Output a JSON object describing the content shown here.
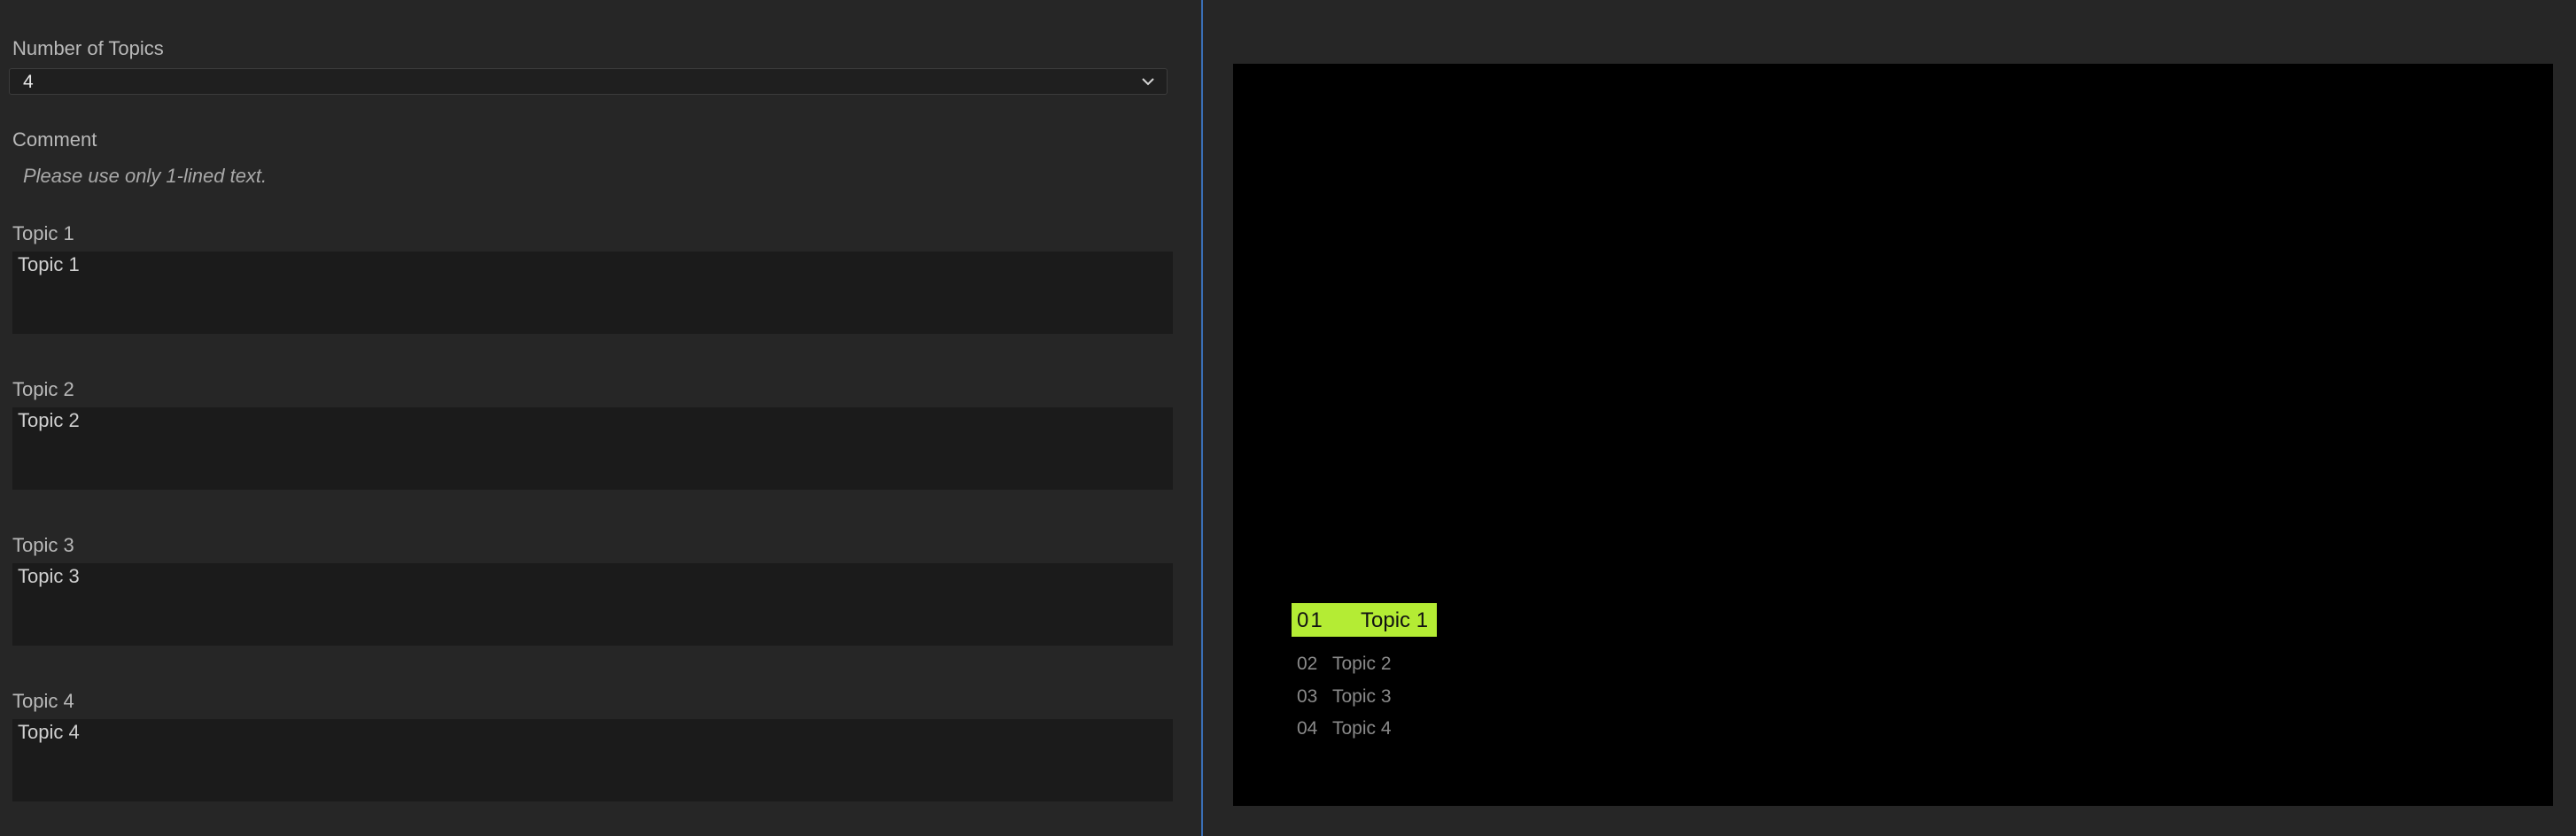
{
  "form": {
    "number_of_topics_label": "Number of Topics",
    "number_of_topics_value": "4",
    "comment_label": "Comment",
    "comment_text": "Please use only 1-lined text.",
    "topics": [
      {
        "label": "Topic 1",
        "value": "Topic 1"
      },
      {
        "label": "Topic 2",
        "value": "Topic 2"
      },
      {
        "label": "Topic 3",
        "value": "Topic 3"
      },
      {
        "label": "Topic 4",
        "value": "Topic 4"
      }
    ]
  },
  "preview": {
    "active_topic": {
      "number": "01",
      "label": "Topic 1"
    },
    "topics": [
      {
        "number": "02",
        "label": "Topic 2"
      },
      {
        "number": "03",
        "label": "Topic 3"
      },
      {
        "number": "04",
        "label": "Topic 4"
      }
    ],
    "highlight_color": "#b4ec34",
    "divider_color": "#3a6fb6"
  }
}
